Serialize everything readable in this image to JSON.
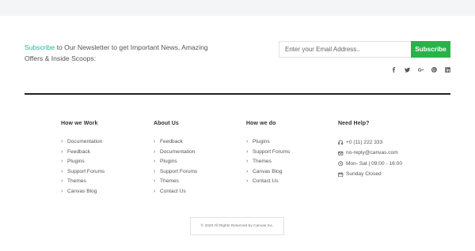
{
  "newsletter": {
    "link_text": "Subscribe",
    "text": " to Our Newsletter to get Important News, Amazing Offers & Inside Scoops:",
    "email_placeholder": "Enter your Email Address..",
    "subscribe_label": "Subscribe"
  },
  "social": [
    "facebook-icon",
    "twitter-icon",
    "google-plus-icon",
    "pinterest-icon",
    "linkedin-icon"
  ],
  "footer": {
    "how_we_work": {
      "title": "How we Work",
      "items": [
        "Documentation",
        "Feedback",
        "Plugins",
        "Support Forums",
        "Themes",
        "Canvas Blog"
      ]
    },
    "about_us": {
      "title": "About Us",
      "items": [
        "Feedback",
        "Documentation",
        "Plugins",
        "Support Forums",
        "Themes",
        "Contact Us"
      ]
    },
    "how_we_do": {
      "title": "How we do",
      "items": [
        "Plugins",
        "Support Forums",
        "Themes",
        "Canvas Blog",
        "Contact Us"
      ]
    },
    "need_help": {
      "title": "Need Help?",
      "items": [
        {
          "icon": "headphones-icon",
          "text": "+0 (11) 222 333"
        },
        {
          "icon": "email-icon",
          "text": "no-reply@canvas.com"
        },
        {
          "icon": "clock-icon",
          "text": "Mon- Sat | 09:00 - 16:00"
        },
        {
          "icon": "calendar-icon",
          "text": "Sunday Closed"
        }
      ]
    }
  },
  "copyright": "© 2020 All Rights Reserved by Canvas Inc."
}
